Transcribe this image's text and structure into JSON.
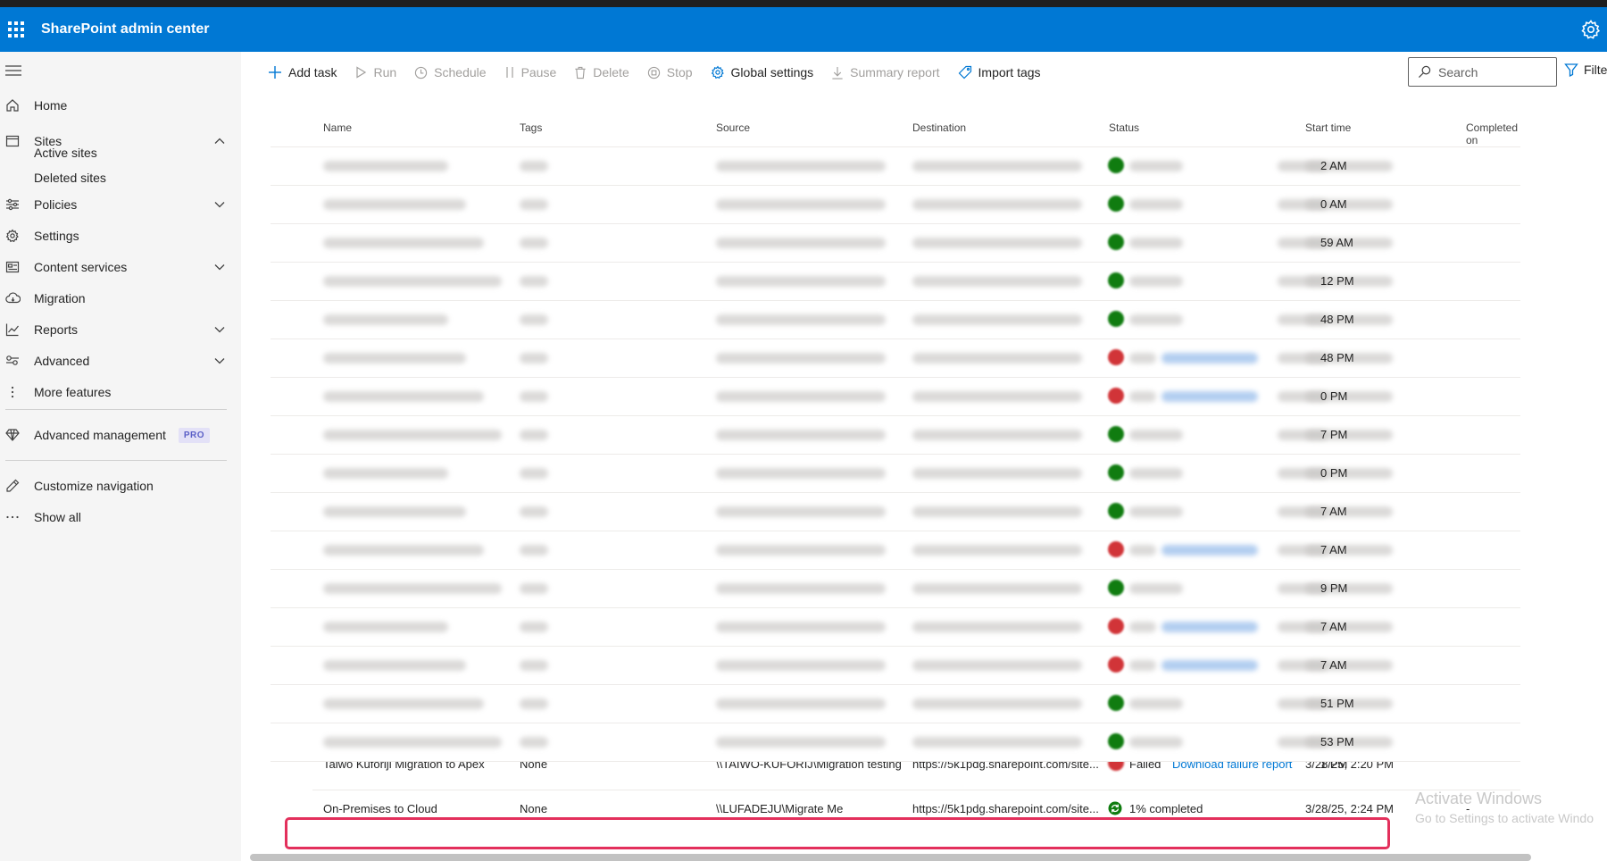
{
  "app": {
    "title": "SharePoint admin center"
  },
  "sidebar": {
    "items": [
      {
        "label": "Home",
        "icon": "home-icon"
      },
      {
        "label": "Sites",
        "icon": "sites-icon"
      },
      {
        "label": "Policies",
        "icon": "policies-icon"
      },
      {
        "label": "Settings",
        "icon": "settings-icon"
      },
      {
        "label": "Content services",
        "icon": "content-services-icon"
      },
      {
        "label": "Migration",
        "icon": "migration-icon"
      },
      {
        "label": "Reports",
        "icon": "reports-icon"
      },
      {
        "label": "Advanced",
        "icon": "advanced-icon"
      },
      {
        "label": "More features",
        "icon": "more-features-icon"
      },
      {
        "label": "Advanced management",
        "icon": "diamond-icon",
        "badge": "PRO"
      },
      {
        "label": "Customize navigation",
        "icon": "pencil-icon"
      },
      {
        "label": "Show all",
        "icon": "ellipsis-icon"
      }
    ],
    "sites_sub": [
      "Active sites",
      "Deleted sites"
    ]
  },
  "toolbar": {
    "add_task": "Add task",
    "run": "Run",
    "schedule": "Schedule",
    "pause": "Pause",
    "delete": "Delete",
    "stop": "Stop",
    "global_settings": "Global settings",
    "summary_report": "Summary report",
    "import_tags": "Import tags",
    "search_label": "Search",
    "filter_label": "Filte"
  },
  "table": {
    "columns": [
      "Name",
      "Tags",
      "Source",
      "Destination",
      "Status",
      "Start time",
      "Completed on"
    ],
    "blurred_rows": [
      {
        "status": "ok",
        "completed_tail": "2 AM"
      },
      {
        "status": "ok",
        "completed_tail": "0 AM"
      },
      {
        "status": "ok",
        "completed_tail": "59 AM"
      },
      {
        "status": "ok",
        "completed_tail": "12 PM"
      },
      {
        "status": "ok",
        "completed_tail": "48 PM"
      },
      {
        "status": "bad",
        "completed_tail": "48 PM"
      },
      {
        "status": "bad",
        "completed_tail": "0 PM"
      },
      {
        "status": "ok",
        "completed_tail": "7 PM"
      },
      {
        "status": "ok",
        "completed_tail": "0 PM"
      },
      {
        "status": "ok",
        "completed_tail": "7 AM"
      },
      {
        "status": "bad",
        "completed_tail": "7 AM"
      },
      {
        "status": "ok",
        "completed_tail": "9 PM"
      },
      {
        "status": "bad",
        "completed_tail": "7 AM"
      },
      {
        "status": "bad",
        "completed_tail": "7 AM"
      },
      {
        "status": "ok",
        "completed_tail": "51 PM"
      },
      {
        "status": "ok",
        "completed_tail": "53 PM"
      }
    ],
    "partial_row": {
      "name": "Taiwo Kuforiji Migration to Apex",
      "tags": "None",
      "source": "\\\\TAIWO-KUFORIJ\\Migration testing",
      "destination": "https://5k1pdg.sharepoint.com/site...",
      "status": "Failed",
      "status_link": "Download failure report",
      "start": "3/28/25, 2:20 PM",
      "completed_tail": "1 PM"
    },
    "selected_row": {
      "name": "On-Premises to Cloud",
      "tags": "None",
      "source": "\\\\LUFADEJU\\Migrate Me",
      "destination": "https://5k1pdg.sharepoint.com/site...",
      "status": "1% completed",
      "start": "3/28/25, 2:24 PM",
      "completed": "-"
    }
  },
  "watermark": {
    "line1": "Activate Windows",
    "line2": "Go to Settings to activate Windo"
  },
  "colors": {
    "brand": "#0078d4",
    "highlight": "#e3305c",
    "ok": "#107c10",
    "bad": "#d13438"
  }
}
